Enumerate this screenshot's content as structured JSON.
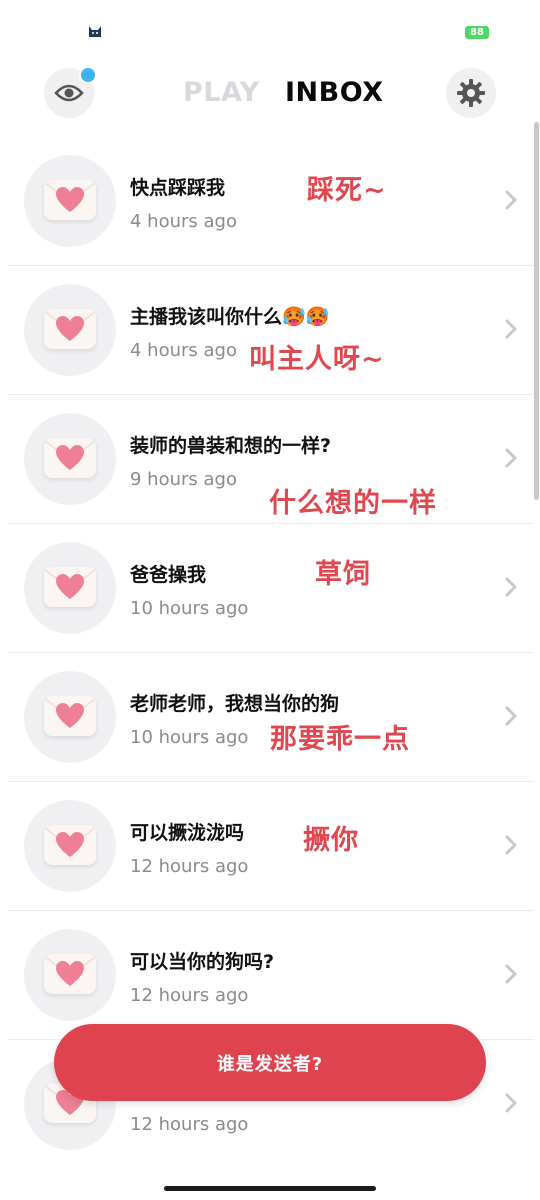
{
  "status_bar": {
    "battery": "88"
  },
  "header": {
    "tab_play": "PLAY",
    "tab_inbox": "INBOX"
  },
  "items": [
    {
      "question": "快点踩踩我",
      "time": "4 hours ago",
      "reply": "踩死~"
    },
    {
      "question": "主播我该叫你什么🥵🥵",
      "time": "4 hours ago",
      "reply": "叫主人呀~"
    },
    {
      "question": "装师的兽装和想的一样?",
      "time": "9 hours ago",
      "reply": "什么想的一样"
    },
    {
      "question": "爸爸操我",
      "time": "10 hours ago",
      "reply": "草饲"
    },
    {
      "question": "老师老师，我想当你的狗",
      "time": "10 hours ago",
      "reply": "那要乖一点"
    },
    {
      "question": "可以撅泷泷吗",
      "time": "12 hours ago",
      "reply": "撅你"
    },
    {
      "question": "可以当你的狗吗?",
      "time": "12 hours ago",
      "reply": ""
    },
    {
      "question": "",
      "time": "12 hours ago",
      "reply": ""
    }
  ],
  "who_button": "谁是发送者?",
  "colors": {
    "accent_red": "#df4350",
    "reply_red": "#e0474f",
    "notification_dot": "#3db3f5"
  },
  "icons": [
    "cat-icon",
    "eye-icon",
    "gear-icon",
    "envelope-heart-icon",
    "chevron-right-icon"
  ]
}
